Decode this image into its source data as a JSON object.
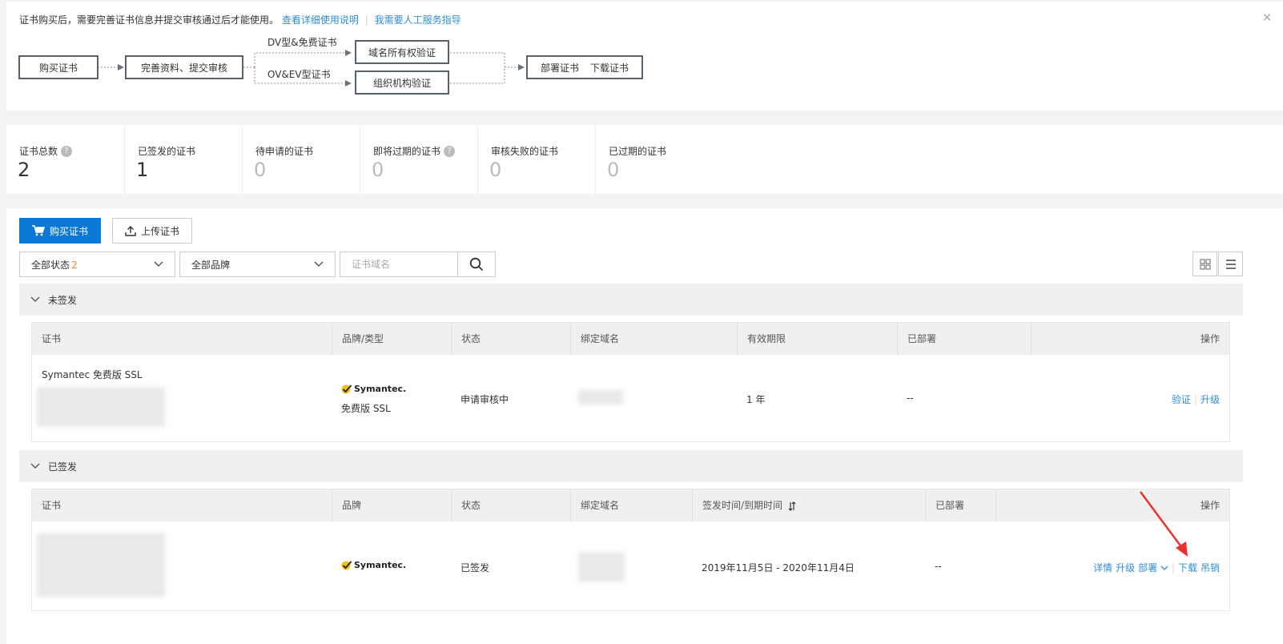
{
  "notice": {
    "text": "证书购买后，需要完善证书信息并提交审核通过后才能使用。",
    "link_docs": "查看详细使用说明",
    "link_service": "我需要人工服务指导",
    "close": "×"
  },
  "flow": {
    "buy": "购买证书",
    "complete": "完善资料、提交审核",
    "dv_label": "DV型&免费证书",
    "ov_label": "OV&EV型证书",
    "domain_verify": "域名所有权验证",
    "org_verify": "组织机构验证",
    "deploy": "部署证书",
    "download": "下载证书"
  },
  "stats": [
    {
      "label": "证书总数",
      "value": "2",
      "help": true
    },
    {
      "label": "已签发的证书",
      "value": "1",
      "help": false
    },
    {
      "label": "待申请的证书",
      "value": "0",
      "help": false
    },
    {
      "label": "即将过期的证书",
      "value": "0",
      "help": true
    },
    {
      "label": "审核失败的证书",
      "value": "0",
      "help": false
    },
    {
      "label": "已过期的证书",
      "value": "0",
      "help": false
    }
  ],
  "toolbar": {
    "buy_label": "购买证书",
    "upload_label": "上传证书",
    "status_filter": "全部状态",
    "status_badge": "2",
    "brand_filter": "全部品牌",
    "search_placeholder": "证书域名"
  },
  "unsigned": {
    "title": "未签发",
    "headers": [
      "证书",
      "品牌/类型",
      "状态",
      "绑定域名",
      "有效期限",
      "已部署",
      "操作"
    ],
    "row": {
      "cert_name": "Symantec 免费版 SSL",
      "brand": "Symantec.",
      "type": "免费版 SSL",
      "status": "申请审核中",
      "validity": "1 年",
      "deployed": "--",
      "op_verify": "验证",
      "op_upgrade": "升级"
    }
  },
  "signed": {
    "title": "已签发",
    "headers": [
      "证书",
      "品牌",
      "状态",
      "绑定域名",
      "签发时间/到期时间",
      "已部署",
      "操作"
    ],
    "row": {
      "brand": "Symantec.",
      "status": "已签发",
      "dates": "2019年11月5日 - 2020年11月4日",
      "deployed": "--",
      "op_detail": "详情",
      "op_upgrade": "升级",
      "op_deploy": "部署",
      "op_download": "下载",
      "op_revoke": "吊销"
    }
  },
  "colors": {
    "primary": "#0c78d6",
    "link": "#2d8ed6",
    "badge": "#f08a2a",
    "annotation_arrow": "#e8322f"
  }
}
